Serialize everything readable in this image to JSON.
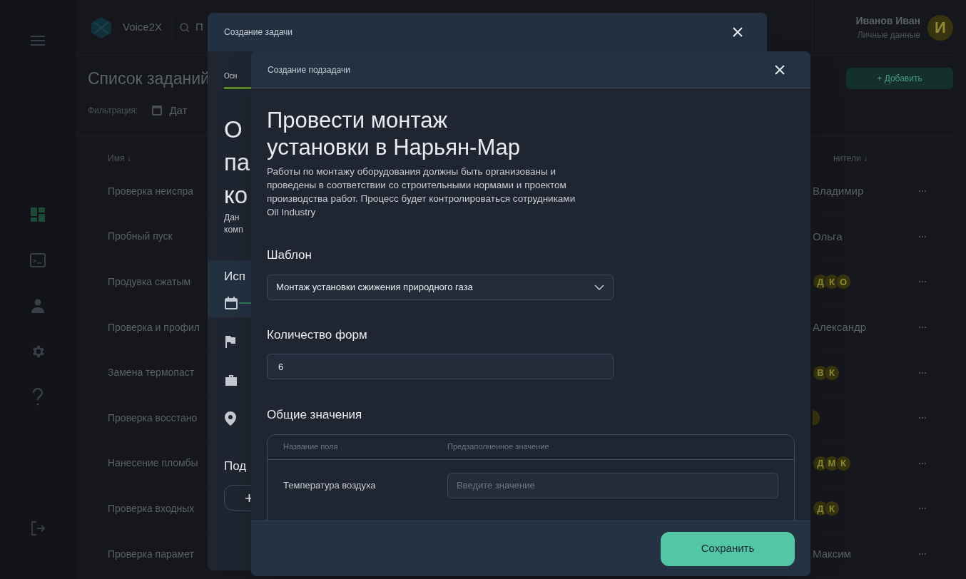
{
  "sidebar": {
    "items": [
      {
        "kind": "dashboard",
        "selected": true
      },
      {
        "kind": "terminal",
        "selected": false
      },
      {
        "kind": "user",
        "selected": false
      },
      {
        "kind": "settings",
        "selected": false
      },
      {
        "kind": "help",
        "selected": false
      }
    ],
    "bottom": {
      "kind": "logout"
    }
  },
  "header": {
    "logo_text": "Voice2X",
    "search_placeholder": "П",
    "user_name": "Иванов Иван",
    "user_subtitle": "Личные данные",
    "avatar": "И"
  },
  "page": {
    "title": "Список заданий",
    "add_button": "+ Добавить",
    "filter_label": "Фильтрация:",
    "date_filter": "Дат"
  },
  "table": {
    "columns": [
      "Имя ↓",
      "нители ↓"
    ],
    "rows": [
      {
        "name": "Проверка неиспра",
        "assignee": {
          "kind": "text",
          "text": "Владимир"
        }
      },
      {
        "name": "Пробный пуск",
        "assignee": {
          "kind": "text",
          "text": "Ольга"
        }
      },
      {
        "name": "Продувка сжатым",
        "assignee": {
          "kind": "avatars",
          "initials": [
            "Д",
            "К",
            "О"
          ]
        }
      },
      {
        "name": "Проверка и профил",
        "assignee": {
          "kind": "text",
          "text": "Александр"
        }
      },
      {
        "name": "Замена термопаст",
        "assignee": {
          "kind": "avatars",
          "initials": [
            "В",
            "К"
          ]
        }
      },
      {
        "name": "Проверка восстано",
        "assignee": {
          "kind": "avatar_edge"
        }
      },
      {
        "name": "Нанесение пломбы",
        "assignee": {
          "kind": "avatars",
          "initials": [
            "Д",
            "М",
            "К"
          ]
        }
      },
      {
        "name": "Проверка входных",
        "assignee": {
          "kind": "avatars",
          "initials": [
            "Д",
            "К"
          ]
        }
      },
      {
        "name": "Проверка парамет",
        "assignee": {
          "kind": "text",
          "text": "Максим"
        }
      }
    ]
  },
  "task_dialog": {
    "title": "Создание задачи",
    "tabs": [
      {
        "label": "Осн",
        "selected": true
      }
    ],
    "heading_lines": [
      "О",
      "па",
      "ко"
    ],
    "description_lines": [
      "Дан",
      "комп"
    ],
    "section": "Исп",
    "info_rows": [
      {
        "kind": "calendar",
        "selected": true
      },
      {
        "kind": "flag",
        "selected": false
      },
      {
        "kind": "briefcase",
        "selected": false
      },
      {
        "kind": "pin",
        "selected": false
      }
    ],
    "subtasks_heading": "Под",
    "add_button": "+"
  },
  "subtask_dialog": {
    "title": "Создание подзадачи",
    "heading": "Провести монтаж установки в Нарьян-Мар",
    "description": "Работы по монтажу оборудования должны быть организованы и проведены в соответствии со строительными нормами и проектом производства работ. Процесс будет контролироваться сотрудниками Oil Industry",
    "template": {
      "label": "Шаблон",
      "value": "Монтаж установки сжижения природного газа"
    },
    "form_count": {
      "label": "Количество форм",
      "value": "6"
    },
    "common_values": {
      "label": "Общие значения",
      "columns": [
        "Название поля",
        "Предзаполненное значение"
      ],
      "rows": [
        {
          "field": "Температура воздуха",
          "placeholder": "Введите значение"
        }
      ]
    },
    "save_button": "Сохранить"
  }
}
